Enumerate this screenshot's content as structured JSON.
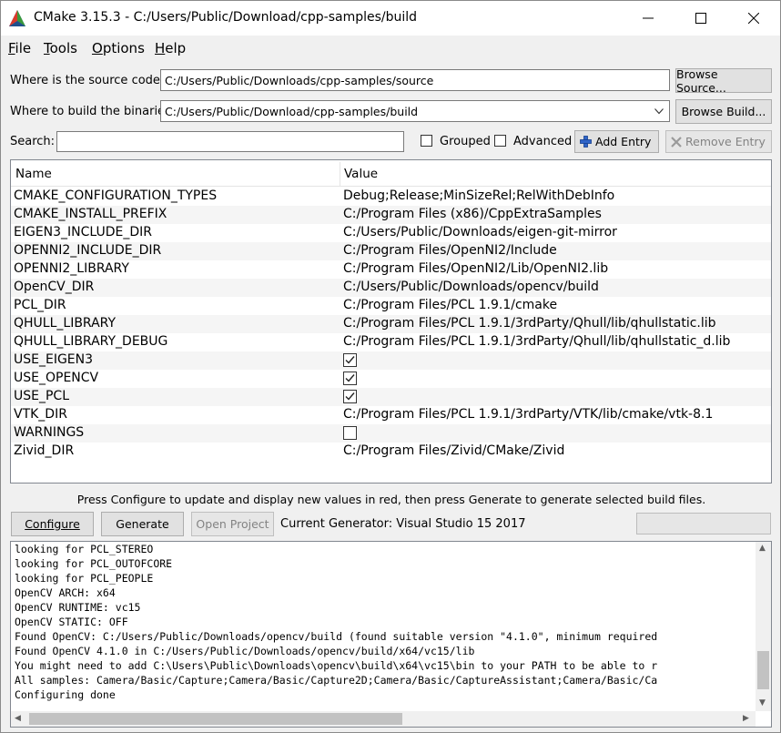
{
  "window": {
    "title": "CMake 3.15.3 - C:/Users/Public/Download/cpp-samples/build"
  },
  "menu": [
    {
      "label": "File",
      "accel": "F",
      "rest": "ile"
    },
    {
      "label": "Tools",
      "accel": "T",
      "rest": "ools"
    },
    {
      "label": "Options",
      "accel": "O",
      "rest": "ptions"
    },
    {
      "label": "Help",
      "accel": "H",
      "rest": "elp"
    }
  ],
  "source": {
    "label": "Where is the source code:",
    "value": "C:/Users/Public/Downloads/cpp-samples/source",
    "button": "Browse Source..."
  },
  "build": {
    "label": "Where to build the binaries:",
    "value": "C:/Users/Public/Download/cpp-samples/build",
    "button": "Browse Build..."
  },
  "search": {
    "label": "Search:",
    "value": ""
  },
  "options": {
    "grouped": "Grouped",
    "advanced": "Advanced",
    "add_entry": "Add Entry",
    "remove_entry": "Remove Entry"
  },
  "table": {
    "headers": {
      "name": "Name",
      "value": "Value"
    },
    "rows": [
      {
        "name": "CMAKE_CONFIGURATION_TYPES",
        "value": "Debug;Release;MinSizeRel;RelWithDebInfo"
      },
      {
        "name": "CMAKE_INSTALL_PREFIX",
        "value": "C:/Program Files (x86)/CppExtraSamples"
      },
      {
        "name": "EIGEN3_INCLUDE_DIR",
        "value": "C:/Users/Public/Downloads/eigen-git-mirror"
      },
      {
        "name": "OPENNI2_INCLUDE_DIR",
        "value": "C:/Program Files/OpenNI2/Include"
      },
      {
        "name": "OPENNI2_LIBRARY",
        "value": "C:/Program Files/OpenNI2/Lib/OpenNI2.lib"
      },
      {
        "name": "OpenCV_DIR",
        "value": "C:/Users/Public/Downloads/opencv/build"
      },
      {
        "name": "PCL_DIR",
        "value": "C:/Program Files/PCL 1.9.1/cmake"
      },
      {
        "name": "QHULL_LIBRARY",
        "value": "C:/Program Files/PCL 1.9.1/3rdParty/Qhull/lib/qhullstatic.lib"
      },
      {
        "name": "QHULL_LIBRARY_DEBUG",
        "value": "C:/Program Files/PCL 1.9.1/3rdParty/Qhull/lib/qhullstatic_d.lib"
      },
      {
        "name": "USE_EIGEN3",
        "check": true
      },
      {
        "name": "USE_OPENCV",
        "check": true
      },
      {
        "name": "USE_PCL",
        "check": true
      },
      {
        "name": "VTK_DIR",
        "value": "C:/Program Files/PCL 1.9.1/3rdParty/VTK/lib/cmake/vtk-8.1"
      },
      {
        "name": "WARNINGS",
        "check": false
      },
      {
        "name": "Zivid_DIR",
        "value": "C:/Program Files/Zivid/CMake/Zivid"
      }
    ]
  },
  "hint": "Press Configure to update and display new values in red, then press Generate to generate selected build files.",
  "actions": {
    "configure": "Configure",
    "generate": "Generate",
    "open_project": "Open Project",
    "generator": "Current Generator: Visual Studio 15 2017"
  },
  "log": [
    "looking for PCL_STEREO",
    "looking for PCL_OUTOFCORE",
    "looking for PCL_PEOPLE",
    "OpenCV ARCH: x64",
    "OpenCV RUNTIME: vc15",
    "OpenCV STATIC: OFF",
    "Found OpenCV: C:/Users/Public/Downloads/opencv/build (found suitable version \"4.1.0\", minimum required",
    "Found OpenCV 4.1.0 in C:/Users/Public/Downloads/opencv/build/x64/vc15/lib",
    "You might need to add C:\\Users\\Public\\Downloads\\opencv\\build\\x64\\vc15\\bin to your PATH to be able to r",
    "All samples: Camera/Basic/Capture;Camera/Basic/Capture2D;Camera/Basic/CaptureAssistant;Camera/Basic/Ca",
    "Configuring done"
  ]
}
